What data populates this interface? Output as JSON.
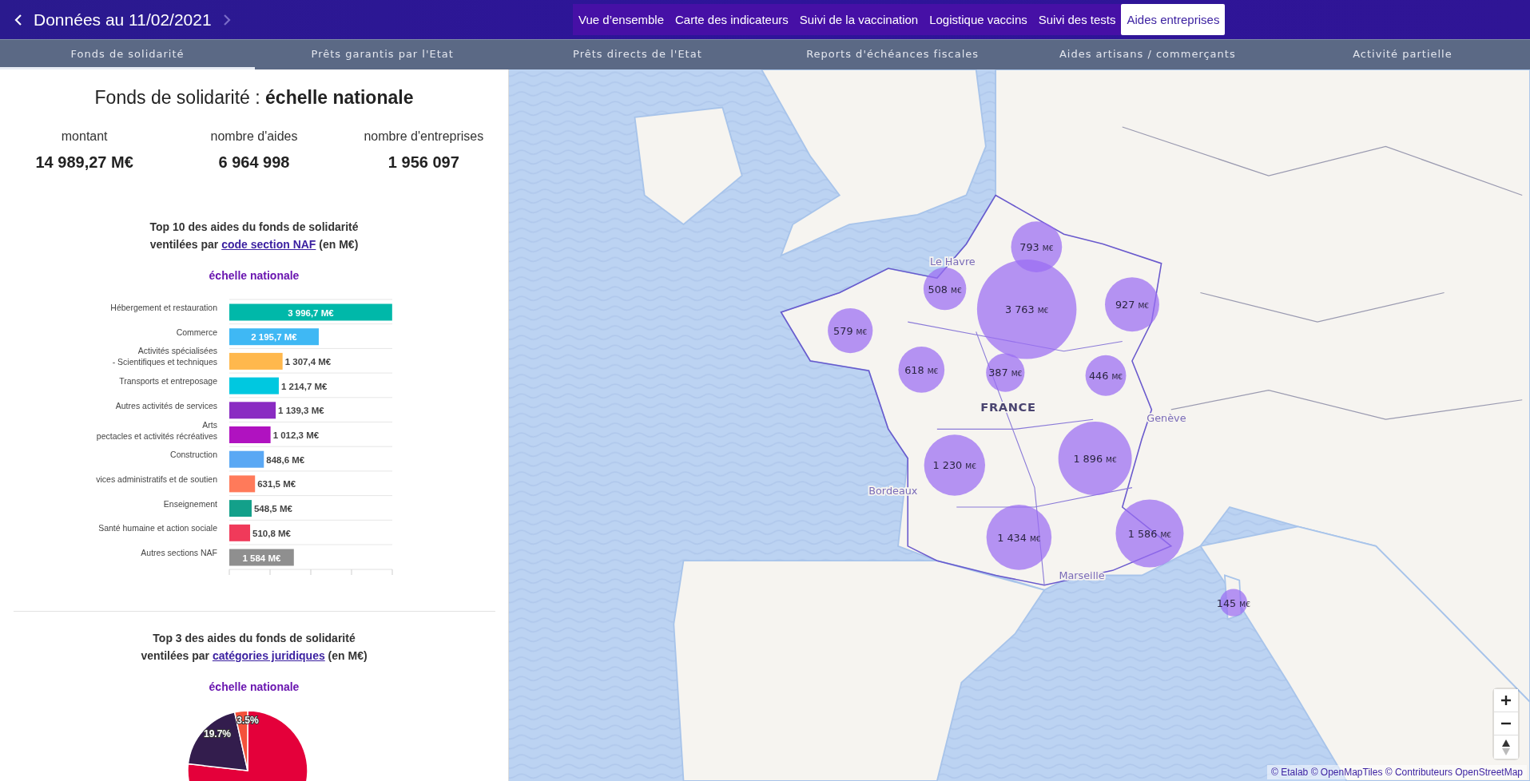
{
  "header": {
    "title": "Données au 11/02/2021",
    "prev": {
      "disabled": false
    },
    "next": {
      "disabled": true
    }
  },
  "nav_tabs": [
    {
      "label": "Vue d’ensemble",
      "selected": false
    },
    {
      "label": "Carte des indicateurs",
      "selected": false
    },
    {
      "label": "Suivi de la vaccination",
      "selected": false
    },
    {
      "label": "Logistique vaccins",
      "selected": false
    },
    {
      "label": "Suivi des tests",
      "selected": false
    },
    {
      "label": "Aides entreprises",
      "selected": true
    }
  ],
  "sub_tabs": [
    {
      "label": "Fonds de solidarité",
      "selected": true
    },
    {
      "label": "Prêts garantis par l'Etat",
      "selected": false
    },
    {
      "label": "Prêts directs de l'Etat",
      "selected": false
    },
    {
      "label": "Reports d'échéances fiscales",
      "selected": false
    },
    {
      "label": "Aides artisans / commerçants",
      "selected": false
    },
    {
      "label": "Activité partielle",
      "selected": false
    }
  ],
  "panel": {
    "title": "Fonds de solidarité : **échelle nationale**",
    "stats": [
      {
        "label": "montant",
        "value": "14 989,27 M€"
      },
      {
        "label": "nombre d'aides",
        "value": "6 964 998"
      },
      {
        "label": "nombre d'entreprises",
        "value": "1 956 097"
      }
    ],
    "naf_section": {
      "title_line1": "Top 10 des aides du fonds de solidarité",
      "title_before": "ventilées par",
      "link": "code section NAF",
      "title_after": "(en M€)",
      "scale": "échelle nationale",
      "chart_data": {
        "type": "bar",
        "orientation": "horizontal",
        "categories": [
          "Hébergement et restauration",
          "Commerce",
          "Activités spécialisées\n- Scientifiques et techniques",
          "Transports et entreposage",
          "Autres activités de services",
          "Arts\npectacles et activités récréatives",
          "Construction",
          "vices administratifs et de soutien",
          "Enseignement",
          "Santé humaine et action sociale",
          "Autres sections NAF"
        ],
        "values": [
          3996.7,
          2195.7,
          1307.4,
          1214.7,
          1139.3,
          1012.3,
          848.6,
          631.5,
          548.5,
          510.8,
          1584
        ],
        "colors": [
          "#00b8a9",
          "#3fb8f4",
          "#ffb84d",
          "#00c8e0",
          "#8a2bc2",
          "#b012c0",
          "#5aa8f4",
          "#ff7a5a",
          "#13a08a",
          "#f03a5a",
          "#8f8f8f"
        ],
        "data_labels": true,
        "value_labels": [
          "3 996,7 M€",
          "2 195,7 M€",
          "1 307,4 M€",
          "1 214,7 M€",
          "1 139,3 M€",
          "1 012,3 M€",
          "848,6 M€",
          "631,5 M€",
          "548,5 M€",
          "510,8 M€",
          "1 584 M€"
        ],
        "xlim": [
          0,
          4000
        ]
      }
    },
    "legal_section": {
      "title_line1": "Top 3 des aides du fonds de solidarité",
      "title_before": "ventilées par",
      "link": "catégories juridiques",
      "title_after": "(en M€)",
      "scale": "échelle nationale",
      "chart_data": {
        "type": "pie",
        "values": [
          76.8,
          19.7,
          3.5
        ],
        "colors": [
          "#e4003a",
          "#331d4d",
          "#f4523b"
        ],
        "data_labels": true,
        "value_labels": [
          null,
          "19.7%",
          "3.5%"
        ]
      }
    }
  },
  "map": {
    "bubbles": [
      {
        "value": "793",
        "unit": "M€"
      },
      {
        "value": "508",
        "unit": "M€"
      },
      {
        "value": "3 763",
        "unit": "M€"
      },
      {
        "value": "927",
        "unit": "M€"
      },
      {
        "value": "579",
        "unit": "M€"
      },
      {
        "value": "618",
        "unit": "M€"
      },
      {
        "value": "387",
        "unit": "M€"
      },
      {
        "value": "446",
        "unit": "M€"
      },
      {
        "value": "1 230",
        "unit": "M€"
      },
      {
        "value": "1 896",
        "unit": "M€"
      },
      {
        "value": "1 434",
        "unit": "M€"
      },
      {
        "value": "1 586",
        "unit": "M€"
      },
      {
        "value": "145",
        "unit": "M€"
      }
    ],
    "labels": [
      {
        "text": "Le Havre",
        "kind": "city"
      },
      {
        "text": "FRANCE",
        "kind": "country"
      },
      {
        "text": "Genève",
        "kind": "city"
      },
      {
        "text": "Bordeaux",
        "kind": "city"
      },
      {
        "text": "Marseille",
        "kind": "city"
      }
    ],
    "attribution": "© Etalab © OpenMapTiles © Contributeurs OpenStreetMap"
  }
}
